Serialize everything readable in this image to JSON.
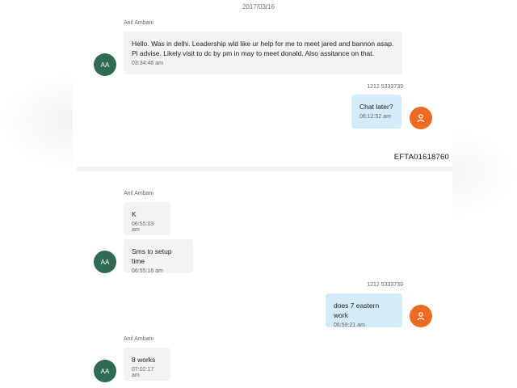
{
  "date": "2017/03/16",
  "ref_number": "EFTA01618760",
  "colors": {
    "incoming_bubble": "#f3f3f3",
    "outgoing_bubble": "#d3ecf7",
    "contact_avatar": "#2f6a52",
    "self_avatar": "#ec6a22"
  },
  "contact": {
    "name": "Anil Ambani",
    "initials": "AA"
  },
  "self": {
    "number": "1212 5333739",
    "avatar_icon": "person-icon"
  },
  "messages": [
    {
      "direction": "incoming",
      "sender": "Anil Ambani",
      "lines": [
        "Hello. Was in delhi. Leadership wld like ur help for me to meet jared and bannon asap.",
        "Pl advise. Likely visit to dc by pm in may to meet donald. Also assitance on that."
      ],
      "time": "03:34:46 am"
    },
    {
      "direction": "outgoing",
      "sender": "1212 5333739",
      "text": "Chat later?",
      "time": "06:12:52 am"
    },
    {
      "direction": "incoming",
      "sender": "Anil Ambani",
      "text": "K",
      "time": "06:55:03 am"
    },
    {
      "direction": "incoming",
      "text": "Sms to setup time",
      "time": "06:55:16 am"
    },
    {
      "direction": "outgoing",
      "sender": "1212 5333739",
      "text": "does 7 eastern work",
      "time": "06:59:21 am"
    },
    {
      "direction": "incoming",
      "sender": "Anil Ambani",
      "text": "8 works",
      "time": "07:02:17 am"
    }
  ]
}
